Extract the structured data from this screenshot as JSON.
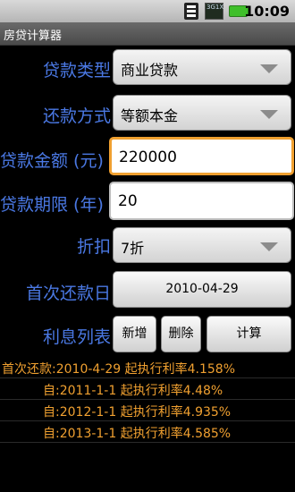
{
  "status_bar": {
    "time": "10:09",
    "network_label": "3G1X",
    "icons": [
      "wifi-icon",
      "signal-icon",
      "battery-icon"
    ]
  },
  "app": {
    "title": "房贷计算器"
  },
  "form": {
    "loan_type": {
      "label": "贷款类型",
      "value": "商业贷款"
    },
    "repayment": {
      "label": "还款方式",
      "value": "等额本金"
    },
    "amount": {
      "label": "贷款金额 (元)",
      "value": "220000"
    },
    "term": {
      "label": "贷款期限 (年)",
      "value": "20"
    },
    "discount": {
      "label": "折扣",
      "value": "7折"
    },
    "first_payment": {
      "label": "首次还款日",
      "value": "2010-04-29"
    },
    "interest_list": {
      "label": "利息列表",
      "add": "新增",
      "delete": "删除",
      "calculate": "计算"
    }
  },
  "rates": [
    "首次还款:2010-4-29 起执行利率4.158%",
    "自:2011-1-1 起执行利率4.48%",
    "自:2012-1-1 起执行利率4.935%",
    "自:2013-1-1 起执行利率4.585%"
  ],
  "colors": {
    "label_blue": "#4a78e3",
    "rate_orange": "#f0a030",
    "focus_orange": "#f0a030"
  }
}
